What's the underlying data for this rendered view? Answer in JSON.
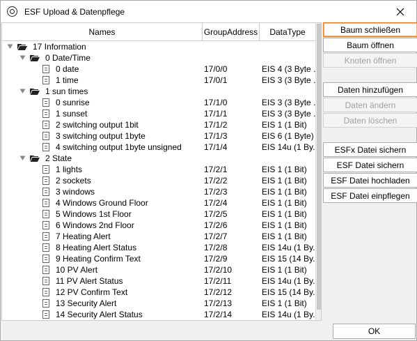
{
  "window": {
    "title": "ESF Upload & Datenpflege",
    "ok_label": "OK"
  },
  "table": {
    "columns": [
      "Names",
      "GroupAddress",
      "DataType"
    ],
    "rows": [
      {
        "level": 0,
        "kind": "folder",
        "label": "17 Information",
        "ga": "",
        "dt": ""
      },
      {
        "level": 1,
        "kind": "folder",
        "label": "0 Date/Time",
        "ga": "",
        "dt": ""
      },
      {
        "level": 2,
        "kind": "item",
        "label": "0 date",
        "ga": "17/0/0",
        "dt": "EIS 4 (3 Byte ..."
      },
      {
        "level": 2,
        "kind": "item",
        "label": "1 time",
        "ga": "17/0/1",
        "dt": "EIS 3 (3 Byte ..."
      },
      {
        "level": 1,
        "kind": "folder",
        "label": "1 sun times",
        "ga": "",
        "dt": ""
      },
      {
        "level": 2,
        "kind": "item",
        "label": "0 sunrise",
        "ga": "17/1/0",
        "dt": "EIS 3 (3 Byte ..."
      },
      {
        "level": 2,
        "kind": "item",
        "label": "1 sunset",
        "ga": "17/1/1",
        "dt": "EIS 3 (3 Byte ..."
      },
      {
        "level": 2,
        "kind": "item",
        "label": "2 switching output 1bit",
        "ga": "17/1/2",
        "dt": "EIS 1 (1 Bit)"
      },
      {
        "level": 2,
        "kind": "item",
        "label": "3 switching output 1byte",
        "ga": "17/1/3",
        "dt": "EIS 6 (1 Byte)"
      },
      {
        "level": 2,
        "kind": "item",
        "label": "4 switching output 1byte unsigned",
        "ga": "17/1/4",
        "dt": "EIS 14u (1 By..."
      },
      {
        "level": 1,
        "kind": "folder",
        "label": "2 State",
        "ga": "",
        "dt": ""
      },
      {
        "level": 2,
        "kind": "item",
        "label": "1 lights",
        "ga": "17/2/1",
        "dt": "EIS 1 (1 Bit)"
      },
      {
        "level": 2,
        "kind": "item",
        "label": "2 sockets",
        "ga": "17/2/2",
        "dt": "EIS 1 (1 Bit)"
      },
      {
        "level": 2,
        "kind": "item",
        "label": "3 windows",
        "ga": "17/2/3",
        "dt": "EIS 1 (1 Bit)"
      },
      {
        "level": 2,
        "kind": "item",
        "label": "4 Windows Ground Floor",
        "ga": "17/2/4",
        "dt": "EIS 1 (1 Bit)"
      },
      {
        "level": 2,
        "kind": "item",
        "label": "5 Windows 1st Floor",
        "ga": "17/2/5",
        "dt": "EIS 1 (1 Bit)"
      },
      {
        "level": 2,
        "kind": "item",
        "label": "6 Windows 2nd Floor",
        "ga": "17/2/6",
        "dt": "EIS 1 (1 Bit)"
      },
      {
        "level": 2,
        "kind": "item",
        "label": "7 Heating Alert",
        "ga": "17/2/7",
        "dt": "EIS 1 (1 Bit)"
      },
      {
        "level": 2,
        "kind": "item",
        "label": "8 Heating Alert Status",
        "ga": "17/2/8",
        "dt": "EIS 14u (1 By..."
      },
      {
        "level": 2,
        "kind": "item",
        "label": "9 Heating Confirm Text",
        "ga": "17/2/9",
        "dt": "EIS 15 (14 By..."
      },
      {
        "level": 2,
        "kind": "item",
        "label": "10 PV Alert",
        "ga": "17/2/10",
        "dt": "EIS 1 (1 Bit)"
      },
      {
        "level": 2,
        "kind": "item",
        "label": "11 PV Alert Status",
        "ga": "17/2/11",
        "dt": "EIS 14u (1 By..."
      },
      {
        "level": 2,
        "kind": "item",
        "label": "12 PV Confirm Text",
        "ga": "17/2/12",
        "dt": "EIS 15 (14 By..."
      },
      {
        "level": 2,
        "kind": "item",
        "label": "13 Security Alert",
        "ga": "17/2/13",
        "dt": "EIS 1 (1 Bit)"
      },
      {
        "level": 2,
        "kind": "item",
        "label": "14 Security Alert Status",
        "ga": "17/2/14",
        "dt": "EIS 14u (1 By..."
      }
    ]
  },
  "buttons": [
    {
      "name": "baum-schliessen-button",
      "label": "Baum schließen",
      "enabled": true,
      "primary": true
    },
    {
      "name": "baum-oeffnen-button",
      "label": "Baum öffnen",
      "enabled": true,
      "primary": false
    },
    {
      "name": "knoten-oeffnen-button",
      "label": "Knoten öffnen",
      "enabled": false,
      "primary": false
    },
    {
      "name": "daten-hinzufuegen-button",
      "label": "Daten hinzufügen",
      "enabled": true,
      "primary": false
    },
    {
      "name": "daten-aendern-button",
      "label": "Daten ändern",
      "enabled": false,
      "primary": false
    },
    {
      "name": "daten-loeschen-button",
      "label": "Daten löschen",
      "enabled": false,
      "primary": false
    },
    {
      "name": "esfx-datei-sichern-button",
      "label": "ESFx Datei sichern",
      "enabled": true,
      "primary": false
    },
    {
      "name": "esf-datei-sichern-button",
      "label": "ESF Datei sichern",
      "enabled": true,
      "primary": false
    },
    {
      "name": "esf-datei-hochladen-button",
      "label": "ESF Datei hochladen",
      "enabled": true,
      "primary": false
    },
    {
      "name": "esf-datei-einpflegen-button",
      "label": "ESF Datei einpflegen",
      "enabled": true,
      "primary": false
    }
  ]
}
